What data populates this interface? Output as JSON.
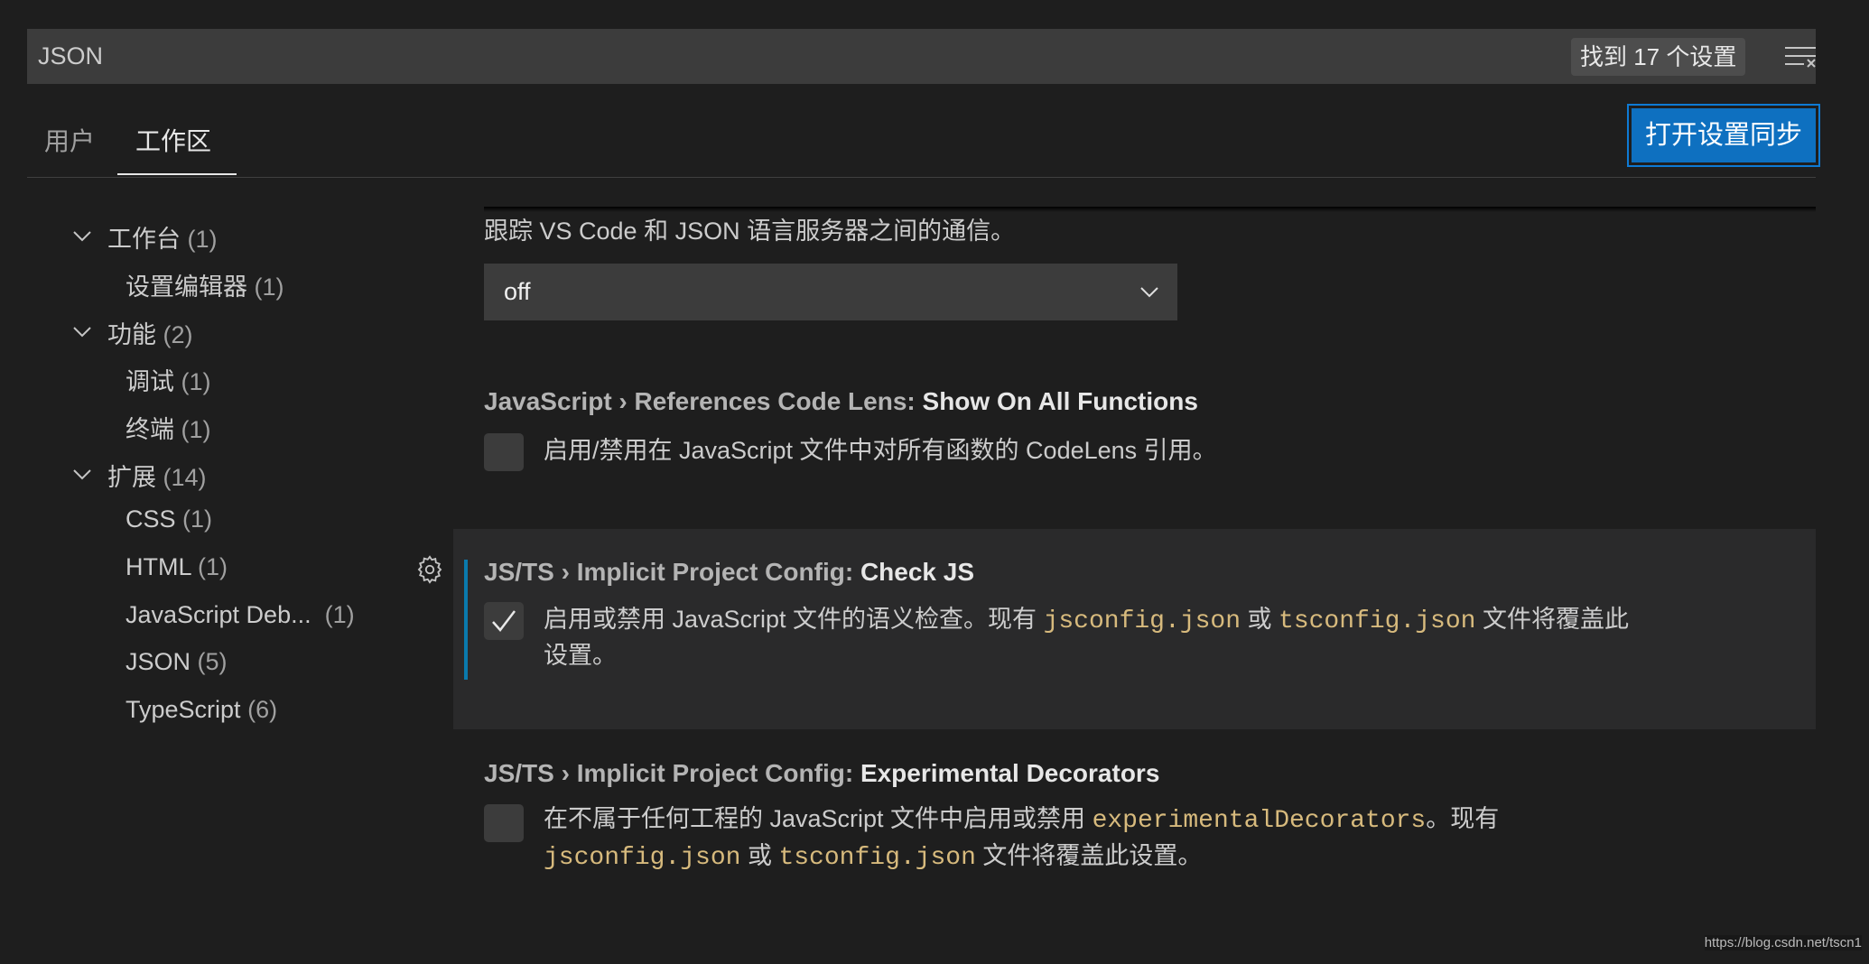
{
  "search": {
    "value": "JSON",
    "result_count": "找到 17 个设置",
    "clear_icon": "clear-filter-icon"
  },
  "tabs": [
    {
      "label": "用户"
    },
    {
      "label": "工作区",
      "active": true
    }
  ],
  "sync_button": "打开设置同步",
  "toc": [
    {
      "label": "工作台",
      "count": "(1)",
      "expanded": true
    },
    {
      "label": "设置编辑器",
      "count": "(1)"
    },
    {
      "label": "功能",
      "count": "(2)",
      "expanded": true
    },
    {
      "label": "调试",
      "count": "(1)"
    },
    {
      "label": "终端",
      "count": "(1)"
    },
    {
      "label": "扩展",
      "count": "(14)",
      "expanded": true
    },
    {
      "label": "CSS",
      "count": "(1)"
    },
    {
      "label": "HTML",
      "count": "(1)"
    },
    {
      "label": "JavaScript Deb...",
      "count": "(1)"
    },
    {
      "label": "JSON",
      "count": "(5)"
    },
    {
      "label": "TypeScript",
      "count": "(6)"
    }
  ],
  "settings": [
    {
      "description": "跟踪 VS Code 和 JSON 语言服务器之间的通信。",
      "value": "off"
    },
    {
      "category": "JavaScript › References Code Lens: ",
      "name": "Show On All Functions",
      "checked": false,
      "description": "启用/禁用在 JavaScript 文件中对所有函数的 CodeLens 引用。"
    },
    {
      "category": "JS/TS › Implicit Project Config: ",
      "name": "Check JS",
      "checked": true,
      "desc_a": "启用或禁用 JavaScript 文件的语义检查。现有 ",
      "code1": "jsconfig.json",
      "desc_b": " 或 ",
      "code2": "tsconfig.json",
      "desc_c": " 文件将覆盖此",
      "desc_d": "设置。"
    },
    {
      "category": "JS/TS › Implicit Project Config: ",
      "name": "Experimental Decorators",
      "checked": false,
      "desc_a": "在不属于任何工程的 JavaScript 文件中启用或禁用 ",
      "code0": "experimentalDecorators",
      "desc_b": "。现有",
      "code1": "jsconfig.json",
      "desc_c": " 或 ",
      "code2": "tsconfig.json",
      "desc_d": " 文件将覆盖此设置。"
    }
  ],
  "watermark": "https://blog.csdn.net/tscn1",
  "colors": {
    "accent": "#0e70c0",
    "code": "#d7ba7d",
    "modified_bar": "#0a7aad"
  }
}
